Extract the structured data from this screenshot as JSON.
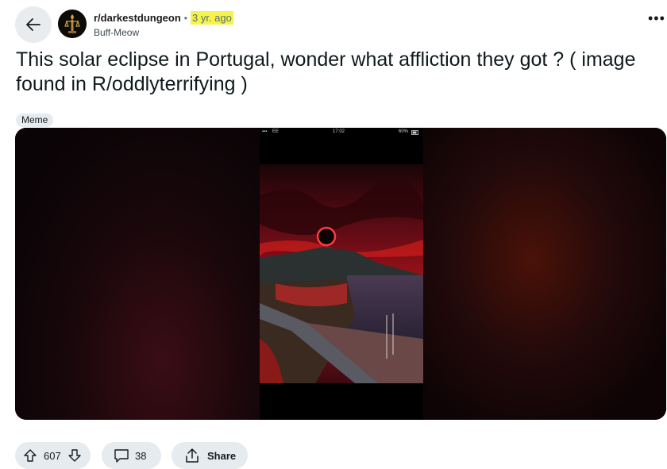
{
  "header": {
    "subreddit": "r/darkestdungeon",
    "separator": "•",
    "age": "3 yr. ago",
    "author": "Buff-Meow",
    "overflow_label": "•••"
  },
  "post": {
    "title": "This solar eclipse in Portugal, wonder what affliction they got ? ( image found in R/oddlyterrifying )",
    "flair": "Meme"
  },
  "phone_status": {
    "carrier": "EE",
    "time": "17:02",
    "battery": "60%"
  },
  "actions": {
    "votes": "607",
    "comments": "38",
    "share_label": "Share"
  },
  "colors": {
    "highlight": "#f7f34a",
    "pill_bg": "#e5ebee",
    "eclipse_ring": "#ff3b3b"
  },
  "icons": [
    "back-arrow-icon",
    "upvote-icon",
    "downvote-icon",
    "comment-icon",
    "share-icon"
  ]
}
